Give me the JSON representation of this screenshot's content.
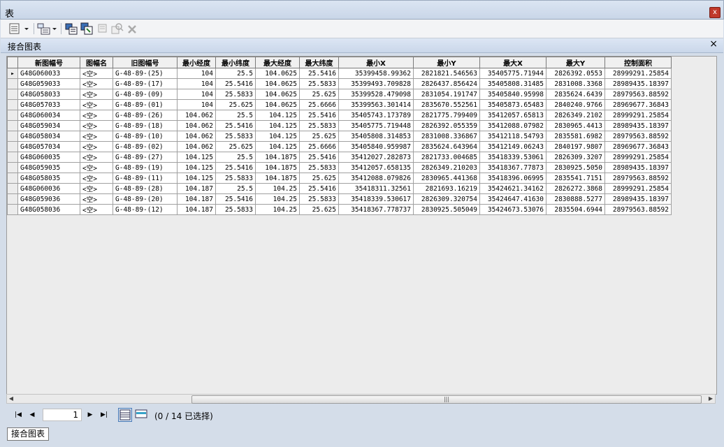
{
  "window": {
    "title": "表",
    "close_label": "x"
  },
  "tab": {
    "title": "接合图表",
    "close_label": "×"
  },
  "table": {
    "headers": [
      "新图幅号",
      "图幅名",
      "旧图幅号",
      "最小经度",
      "最小纬度",
      "最大经度",
      "最大纬度",
      "最小X",
      "最小Y",
      "最大X",
      "最大Y",
      "控制面积"
    ],
    "rows": [
      [
        "G48G060033",
        "<空>",
        "G-48-89-(25)",
        "104",
        "25.5",
        "104.0625",
        "25.5416",
        "35399458.99362",
        "2821821.546563",
        "35405775.71944",
        "2826392.0553",
        "28999291.25854"
      ],
      [
        "G48G059033",
        "<空>",
        "G-48-89-(17)",
        "104",
        "25.5416",
        "104.0625",
        "25.5833",
        "35399493.709828",
        "2826437.856424",
        "35405808.31485",
        "2831008.3368",
        "28989435.18397"
      ],
      [
        "G48G058033",
        "<空>",
        "G-48-89-(09)",
        "104",
        "25.5833",
        "104.0625",
        "25.625",
        "35399528.479098",
        "2831054.191747",
        "35405840.95998",
        "2835624.6439",
        "28979563.88592"
      ],
      [
        "G48G057033",
        "<空>",
        "G-48-89-(01)",
        "104",
        "25.625",
        "104.0625",
        "25.6666",
        "35399563.301414",
        "2835670.552561",
        "35405873.65483",
        "2840240.9766",
        "28969677.36843"
      ],
      [
        "G48G060034",
        "<空>",
        "G-48-89-(26)",
        "104.062",
        "25.5",
        "104.125",
        "25.5416",
        "35405743.173789",
        "2821775.799409",
        "35412057.65813",
        "2826349.2102",
        "28999291.25854"
      ],
      [
        "G48G059034",
        "<空>",
        "G-48-89-(18)",
        "104.062",
        "25.5416",
        "104.125",
        "25.5833",
        "35405775.719448",
        "2826392.055359",
        "35412088.07982",
        "2830965.4413",
        "28989435.18397"
      ],
      [
        "G48G058034",
        "<空>",
        "G-48-89-(10)",
        "104.062",
        "25.5833",
        "104.125",
        "25.625",
        "35405808.314853",
        "2831008.336867",
        "35412118.54793",
        "2835581.6982",
        "28979563.88592"
      ],
      [
        "G48G057034",
        "<空>",
        "G-48-89-(02)",
        "104.062",
        "25.625",
        "104.125",
        "25.6666",
        "35405840.959987",
        "2835624.643964",
        "35412149.06243",
        "2840197.9807",
        "28969677.36843"
      ],
      [
        "G48G060035",
        "<空>",
        "G-48-89-(27)",
        "104.125",
        "25.5",
        "104.1875",
        "25.5416",
        "35412027.282873",
        "2821733.004685",
        "35418339.53061",
        "2826309.3207",
        "28999291.25854"
      ],
      [
        "G48G059035",
        "<空>",
        "G-48-89-(19)",
        "104.125",
        "25.5416",
        "104.1875",
        "25.5833",
        "35412057.658135",
        "2826349.210203",
        "35418367.77873",
        "2830925.5050",
        "28989435.18397"
      ],
      [
        "G48G058035",
        "<空>",
        "G-48-89-(11)",
        "104.125",
        "25.5833",
        "104.1875",
        "25.625",
        "35412088.079826",
        "2830965.441368",
        "35418396.06995",
        "2835541.7151",
        "28979563.88592"
      ],
      [
        "G48G060036",
        "<空>",
        "G-48-89-(28)",
        "104.187",
        "25.5",
        "104.25",
        "25.5416",
        "35418311.32561",
        "2821693.16219",
        "35424621.34162",
        "2826272.3868",
        "28999291.25854"
      ],
      [
        "G48G059036",
        "<空>",
        "G-48-89-(20)",
        "104.187",
        "25.5416",
        "104.25",
        "25.5833",
        "35418339.530617",
        "2826309.320754",
        "35424647.41630",
        "2830888.5277",
        "28989435.18397"
      ],
      [
        "G48G058036",
        "<空>",
        "G-48-89-(12)",
        "104.187",
        "25.5833",
        "104.25",
        "25.625",
        "35418367.778737",
        "2830925.505049",
        "35424673.53076",
        "2835504.6944",
        "28979563.88592"
      ]
    ]
  },
  "nav": {
    "page": "1",
    "status": "(0 / 14 已选择)"
  },
  "bottom_tab": {
    "label": "接合图表"
  }
}
